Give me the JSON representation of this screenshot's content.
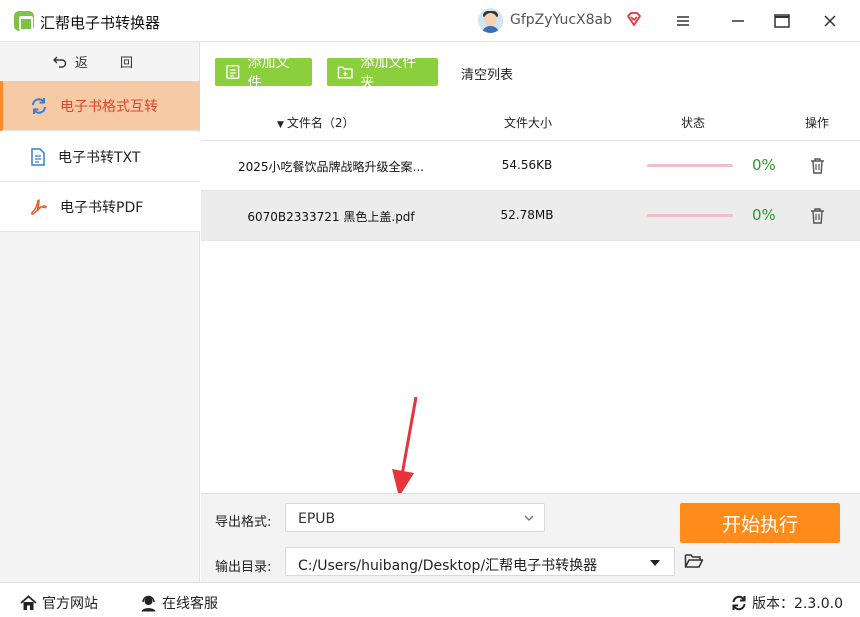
{
  "app": {
    "title": "汇帮电子书转换器",
    "username": "GfpZyYucX8ab",
    "brand_color": "#8ccf3c",
    "accent_color": "#ff8c1a"
  },
  "sidebar": {
    "back_label": "返 回",
    "items": [
      {
        "label": "电子书格式互转",
        "icon": "refresh-icon",
        "active": true
      },
      {
        "label": "电子书转TXT",
        "icon": "document-icon",
        "active": false
      },
      {
        "label": "电子书转PDF",
        "icon": "pdf-icon",
        "active": false
      }
    ]
  },
  "toolbar": {
    "add_file": "添加文件",
    "add_folder": "添加文件夹",
    "clear_list": "清空列表"
  },
  "table": {
    "headers": {
      "name": "文件名（2）",
      "size": "文件大小",
      "status": "状态",
      "ops": "操作"
    },
    "rows": [
      {
        "name": "2025小吃餐饮品牌战略升级全案...",
        "size": "54.56KB",
        "progress": "0%",
        "progress_value": 0
      },
      {
        "name": "6070B2333721 黑色上盖.pdf",
        "size": "52.78MB",
        "progress": "0%",
        "progress_value": 0
      }
    ]
  },
  "settings": {
    "format_label": "导出格式:",
    "format_value": "EPUB",
    "output_label": "输出目录:",
    "output_value": "C:/Users/huibang/Desktop/汇帮电子书转换器",
    "start_label": "开始执行"
  },
  "footer": {
    "website": "官方网站",
    "service": "在线客服",
    "version": "版本：2.3.0.0"
  }
}
